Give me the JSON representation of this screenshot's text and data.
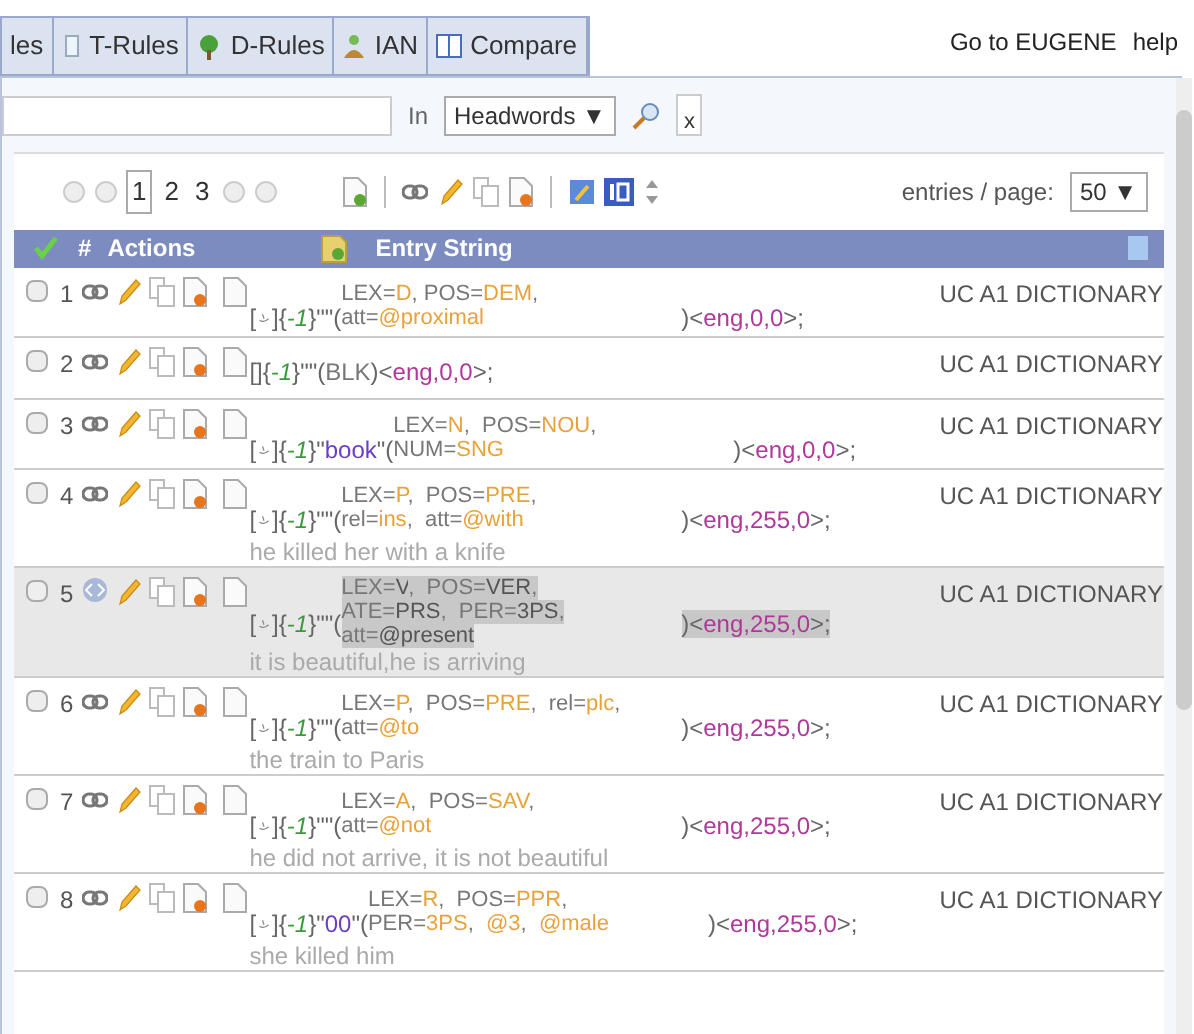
{
  "tabs": [
    {
      "label": "les",
      "kind": "plain",
      "selected": false
    },
    {
      "label": "T-Rules",
      "kind": "rules",
      "selected": false
    },
    {
      "label": "D-Rules",
      "kind": "tree",
      "selected": false
    },
    {
      "label": "IAN",
      "kind": "person",
      "selected": false
    },
    {
      "label": "Compare",
      "kind": "columns",
      "selected": false
    }
  ],
  "top_links": [
    "Go to EUGENE",
    "help"
  ],
  "search": {
    "in_label": "In",
    "scope": "Headwords ▼",
    "clear": "x"
  },
  "pager": {
    "pages": [
      {
        "label": "1",
        "selected": true
      },
      {
        "label": "2",
        "selected": false
      },
      {
        "label": "3",
        "selected": false
      }
    ],
    "entries_label": "entries / page:",
    "entries_value": "50 ▼"
  },
  "table": {
    "columns": [
      "#",
      "Actions",
      "Entry String"
    ],
    "rows": [
      {
        "num": "1",
        "selected": false,
        "checked": false,
        "kind": "stacked",
        "open": "[",
        "close": "]",
        "rank": [
          "{",
          "-1",
          "}"
        ],
        "lemma": [
          "\"\"("
        ],
        "attrs": [
          [
            "LEX=",
            "D",
            ", POS=",
            "DEM",
            ","
          ],
          [
            "att=",
            "@proximal"
          ]
        ],
        "tail": [
          ")<",
          "eng,0,0",
          ">;"
        ],
        "dictionary": "UC A1 DICTIONARY"
      },
      {
        "num": "2",
        "selected": false,
        "checked": false,
        "kind": "inline",
        "brackets": "[]",
        "rank": [
          "{",
          "-1",
          "}"
        ],
        "inline_lemma": [
          "\"\"("
        ],
        "attrs": [
          [
            "BLK"
          ]
        ],
        "closing": [
          ")<",
          "eng,0,0",
          ">;"
        ],
        "dictionary": "UC A1 DICTIONARY"
      },
      {
        "num": "3",
        "selected": false,
        "checked": false,
        "kind": "stacked",
        "open": "[",
        "close": "]",
        "rank": [
          "{",
          "-1",
          "}"
        ],
        "lemma": [
          "\"",
          "book",
          "\"("
        ],
        "attrs": [
          [
            "LEX=",
            "N",
            ",  POS=",
            "NOU",
            ","
          ],
          [
            "NUM=",
            "SNG"
          ]
        ],
        "tail": [
          ")<",
          "eng,0,0",
          ">;"
        ],
        "dictionary": "UC A1 DICTIONARY"
      },
      {
        "num": "4",
        "selected": false,
        "checked": false,
        "kind": "stacked",
        "open": "[",
        "close": "]",
        "rank": [
          "{",
          "-1",
          "}"
        ],
        "lemma": [
          "\"\"("
        ],
        "attrs": [
          [
            "LEX=",
            "P",
            ",  POS=",
            "PRE",
            ","
          ],
          [
            "rel=",
            "ins",
            ",  att=",
            "@with"
          ]
        ],
        "tail": [
          ")<",
          "eng,255,0",
          ">;"
        ],
        "gloss": "he killed her with a knife",
        "dictionary": "UC A1 DICTIONARY"
      },
      {
        "num": "5",
        "selected": true,
        "checked": false,
        "kind": "stacked",
        "open": "[",
        "close": "]",
        "rank": [
          "{",
          "-1",
          "}"
        ],
        "lemma": [
          "\"\"("
        ],
        "attrs": [
          [
            "LEX=",
            "V",
            ",  POS=",
            "VER",
            ","
          ],
          [
            "ATE=",
            "PRS",
            ",  PER=",
            "3PS",
            ","
          ],
          [
            "att=",
            "@present"
          ]
        ],
        "tail": [
          ")<",
          "eng,255,0",
          ">;"
        ],
        "gloss": "it is beautiful,he is arriving",
        "dictionary": "UC A1 DICTIONARY"
      },
      {
        "num": "6",
        "selected": false,
        "checked": false,
        "kind": "stacked",
        "open": "[",
        "close": "]",
        "rank": [
          "{",
          "-1",
          "}"
        ],
        "lemma": [
          "\"\"("
        ],
        "attrs": [
          [
            "LEX=",
            "P",
            ",  POS=",
            "PRE",
            ",  rel=",
            "plc",
            ","
          ],
          [
            "att=",
            "@to"
          ]
        ],
        "tail": [
          ")<",
          "eng,255,0",
          ">;"
        ],
        "gloss": "the train to Paris",
        "dictionary": "UC A1 DICTIONARY"
      },
      {
        "num": "7",
        "selected": false,
        "checked": false,
        "kind": "stacked",
        "open": "[",
        "close": "]",
        "rank": [
          "{",
          "-1",
          "}"
        ],
        "lemma": [
          "\"\"("
        ],
        "attrs": [
          [
            "LEX=",
            "A",
            ",  POS=",
            "SAV",
            ","
          ],
          [
            "att=",
            "@not"
          ]
        ],
        "tail": [
          ")<",
          "eng,255,0",
          ">;"
        ],
        "gloss": "he did not arrive, it is not beautiful",
        "dictionary": "UC A1 DICTIONARY"
      },
      {
        "num": "8",
        "selected": false,
        "checked": false,
        "kind": "stacked",
        "open": "[",
        "close": "]",
        "rank": [
          "{",
          "-1",
          "}"
        ],
        "lemma": [
          "\"",
          "00",
          "\"("
        ],
        "attrs": [
          [
            "LEX=",
            "R",
            ",  POS=",
            "PPR",
            ","
          ],
          [
            "PER=",
            "3PS",
            ",  ",
            "@3",
            ",  ",
            "@male"
          ]
        ],
        "tail": [
          ")<",
          "eng,255,0",
          ">;"
        ],
        "gloss": "she killed him",
        "dictionary": "UC A1 DICTIONARY"
      }
    ]
  }
}
